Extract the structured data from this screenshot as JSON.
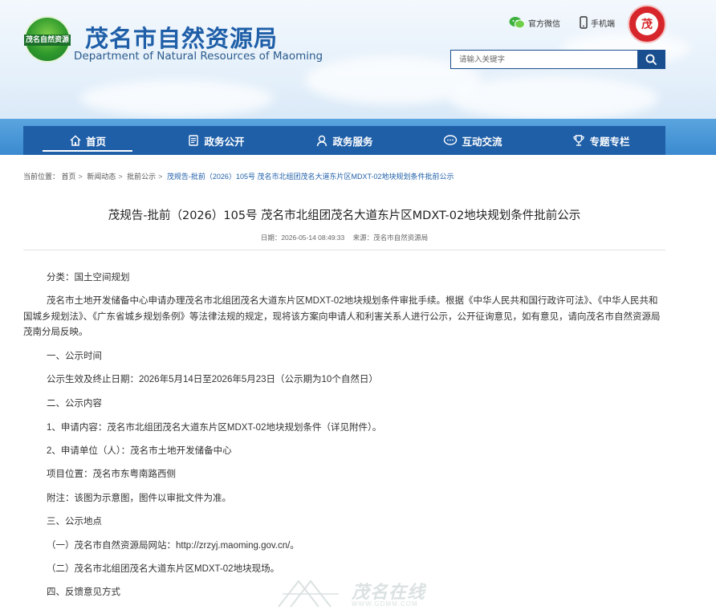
{
  "header": {
    "logo_text": "茂名自然资源",
    "title_cn": "茂名市自然资源局",
    "title_en": "Department of Natural Resources of Maoming",
    "wechat_label": "官方微信",
    "mobile_label": "手机端",
    "badge_text": "茂",
    "search_placeholder": "请输入关键字"
  },
  "nav": {
    "items": [
      {
        "label": "首页",
        "icon": "home-icon"
      },
      {
        "label": "政务公开",
        "icon": "document-icon"
      },
      {
        "label": "政务服务",
        "icon": "service-icon"
      },
      {
        "label": "互动交流",
        "icon": "chat-icon"
      },
      {
        "label": "专题专栏",
        "icon": "trophy-icon"
      }
    ],
    "active": "首页"
  },
  "breadcrumb": {
    "prefix": "当前位置：",
    "items": [
      "首页",
      "新闻动态",
      "批前公示"
    ],
    "current": "茂规告-批前（2026）105号 茂名市北组团茂名大道东片区MDXT-02地块规划条件批前公示"
  },
  "article": {
    "title": "茂规告-批前（2026）105号 茂名市北组团茂名大道东片区MDXT-02地块规划条件批前公示",
    "date": "日期：2026-05-14 08:49:33",
    "source": "来源：茂名市自然资源局",
    "category": "分类：国土空间规划",
    "intro": "茂名市土地开发储备中心申请办理茂名市北组团茂名大道东片区MDXT-02地块规划条件审批手续。根据《中华人民共和国行政许可法》、《中华人民共和国城乡规划法》、《广东省城乡规划条例》等法律法规的规定，现将该方案向申请人和利害关系人进行公示，公开征询意见，如有意见，请向茂名市自然资源局茂南分局反映。",
    "sec1": "一、公示时间",
    "period": "公示生效及终止日期：2026年5月14日至2026年5月23日（公示期为10个自然日）",
    "sec2": "二、公示内容",
    "item1": "1、申请内容：茂名市北组团茂名大道东片区MDXT-02地块规划条件（详见附件）。",
    "item2": "2、申请单位（人）：茂名市土地开发储备中心",
    "location": "项目位置：茂名市东粤南路西侧",
    "note": "附注：该图为示意图，图件以审批文件为准。",
    "sec3": "三、公示地点",
    "place1": "（一）茂名市自然资源局网站：http://zrzyj.maoming.gov.cn/。",
    "place2": "（二）茂名市北组团茂名大道东片区MDXT-02地块现场。",
    "sec4": "四、反馈意见方式"
  },
  "watermark": {
    "text": "茂名在线",
    "url": "WWW.GDMM.COM"
  }
}
